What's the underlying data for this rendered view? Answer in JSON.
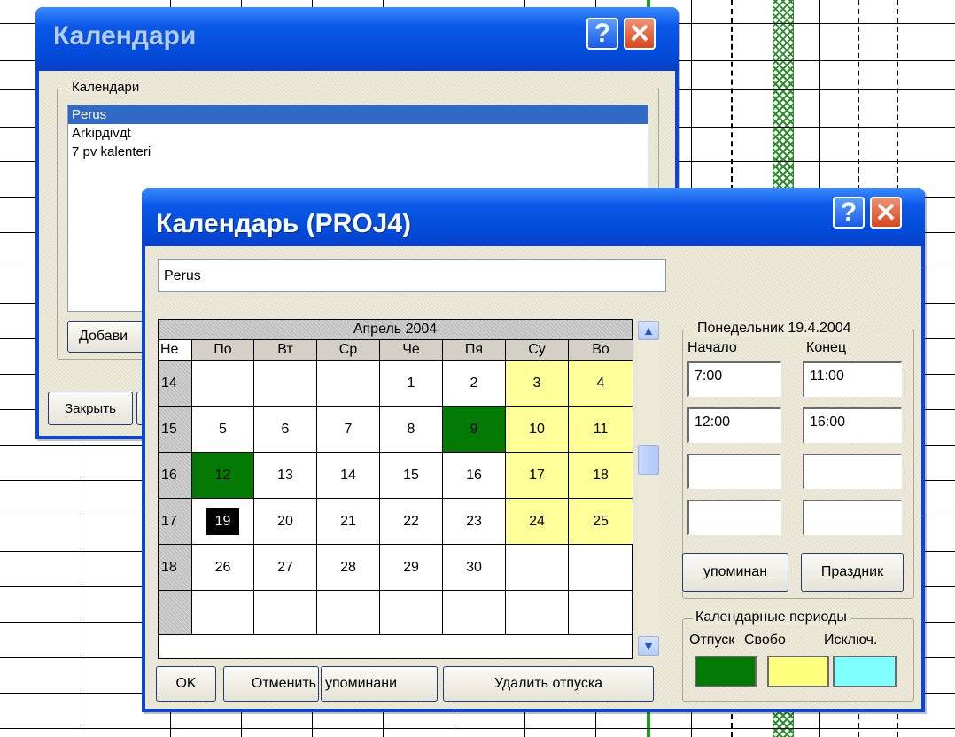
{
  "back_window": {
    "title": "Календари",
    "group_label": "Календари",
    "calendars": [
      {
        "name": "Perus",
        "selected": true
      },
      {
        "name": "Arkipдivдt",
        "selected": false
      },
      {
        "name": "7 pv kalenteri",
        "selected": false
      }
    ],
    "add_button": "Добави",
    "close_button": "Закрыть"
  },
  "front_window": {
    "title": "Календарь (PROJ4)",
    "calendar_name": "Perus",
    "month_label": "Апрель 2004",
    "week_header": "Не",
    "day_headers": [
      "По",
      "Вт",
      "Ср",
      "Че",
      "Пя",
      "Су",
      "Во"
    ],
    "weeks": [
      {
        "week": "14",
        "days": [
          {
            "d": ""
          },
          {
            "d": ""
          },
          {
            "d": ""
          },
          {
            "d": "1"
          },
          {
            "d": "2"
          },
          {
            "d": "3",
            "type": "weekend"
          },
          {
            "d": "4",
            "type": "weekend"
          }
        ]
      },
      {
        "week": "15",
        "days": [
          {
            "d": "5"
          },
          {
            "d": "6"
          },
          {
            "d": "7"
          },
          {
            "d": "8"
          },
          {
            "d": "9",
            "type": "vacation"
          },
          {
            "d": "10",
            "type": "weekend"
          },
          {
            "d": "11",
            "type": "weekend"
          }
        ]
      },
      {
        "week": "16",
        "days": [
          {
            "d": "12",
            "type": "vacation"
          },
          {
            "d": "13"
          },
          {
            "d": "14"
          },
          {
            "d": "15"
          },
          {
            "d": "16"
          },
          {
            "d": "17",
            "type": "weekend"
          },
          {
            "d": "18",
            "type": "weekend"
          }
        ]
      },
      {
        "week": "17",
        "days": [
          {
            "d": "19",
            "type": "selected"
          },
          {
            "d": "20"
          },
          {
            "d": "21"
          },
          {
            "d": "22"
          },
          {
            "d": "23"
          },
          {
            "d": "24",
            "type": "weekend"
          },
          {
            "d": "25",
            "type": "weekend"
          }
        ]
      },
      {
        "week": "18",
        "days": [
          {
            "d": "26"
          },
          {
            "d": "27"
          },
          {
            "d": "28"
          },
          {
            "d": "29"
          },
          {
            "d": "30"
          },
          {
            "d": ""
          },
          {
            "d": ""
          }
        ]
      },
      {
        "week": "",
        "days": [
          {
            "d": ""
          },
          {
            "d": ""
          },
          {
            "d": ""
          },
          {
            "d": ""
          },
          {
            "d": ""
          },
          {
            "d": ""
          },
          {
            "d": ""
          }
        ]
      }
    ],
    "day_panel": {
      "label": "Понедельник 19.4.2004",
      "start_label": "Начало",
      "end_label": "Конец",
      "periods": [
        {
          "start": "7:00",
          "end": "11:00"
        },
        {
          "start": "12:00",
          "end": "16:00"
        },
        {
          "start": "",
          "end": ""
        },
        {
          "start": "",
          "end": ""
        }
      ],
      "reminder_button": "упоминан",
      "holiday_button": "Праздник"
    },
    "periods_legend": {
      "label": "Календарные периоды",
      "items": [
        {
          "label": "Отпуск",
          "color": "#037a03"
        },
        {
          "label": "Свобо",
          "color": "#ffff80"
        },
        {
          "label": "Исключ.",
          "color": "#80ffff"
        }
      ]
    },
    "buttons": {
      "ok": "OK",
      "cancel": "Отменить",
      "reminder": "упоминани",
      "delete_vacations": "Удалить отпуска"
    }
  },
  "colors": {
    "weekend": "#ffff99",
    "vacation": "#037a03",
    "xp_title": "#0a58e8"
  }
}
